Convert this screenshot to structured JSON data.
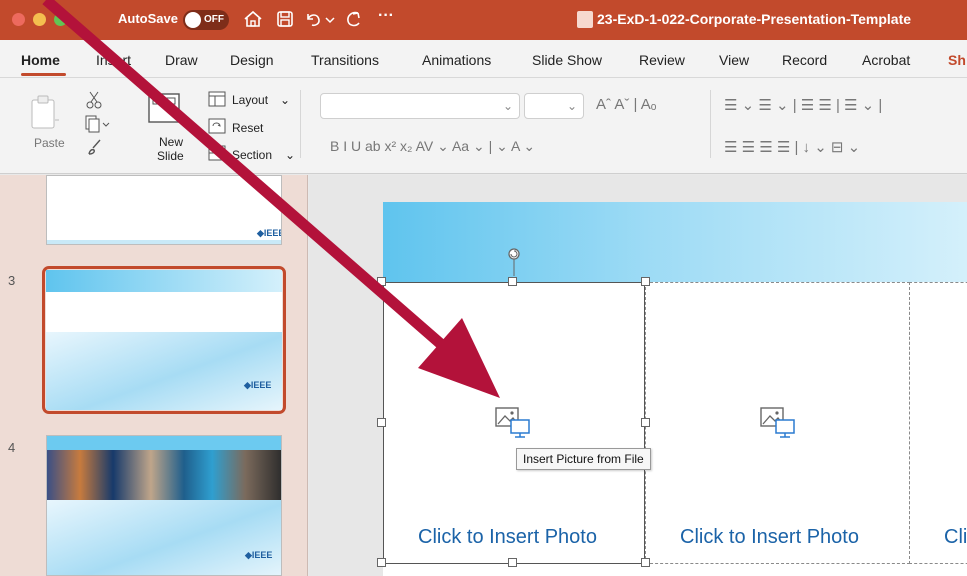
{
  "titlebar": {
    "autosave_label": "AutoSave",
    "toggle_state": "OFF",
    "more_glyph": "···",
    "filename": "23-ExD-1-022-Corporate-Presentation-Template",
    "colors": {
      "bar": "#c24a2c",
      "close": "#ed6a5e",
      "min": "#f4bf4f",
      "max": "#61c554"
    }
  },
  "tabs": [
    "Home",
    "Insert",
    "Draw",
    "Design",
    "Transitions",
    "Animations",
    "Slide Show",
    "Review",
    "View",
    "Record",
    "Acrobat",
    "Sh"
  ],
  "active_tab": "Home",
  "ribbon": {
    "paste_label": "Paste",
    "new_slide_line1": "New",
    "new_slide_line2": "Slide",
    "layout_label": "Layout",
    "reset_label": "Reset",
    "section_label": "Section",
    "font_row_glyphs": "Aˆ  Aˇ  |  Aₒ",
    "format_row": "B   I   U   ab   x²   x₂   AV ⌄   Aa ⌄  |   ⌄   A ⌄",
    "para_row1": "☰ ⌄  ☰ ⌄  |  ☰  ☰  |  ☰ ⌄  |",
    "para_row2": "☰  ☰  ☰  ☰  |  ↓ ⌄  ⊟ ⌄"
  },
  "thumbnails": [
    {
      "number": "",
      "logo": "◆IEEE"
    },
    {
      "number": "3",
      "logo": "◆IEEE"
    },
    {
      "number": "4",
      "logo": "◆IEEE"
    }
  ],
  "slide": {
    "placeholders": [
      {
        "label": "Click to Insert Photo"
      },
      {
        "label": "Click to Insert Photo"
      },
      {
        "label": "Cli"
      }
    ],
    "tooltip": "Insert Picture from File"
  },
  "icons": {
    "home": "home-icon",
    "save": "save-icon",
    "undo": "undo-icon",
    "redo": "redo-icon",
    "cut": "scissors-icon",
    "copy": "copy-icon",
    "format_painter": "brush-icon",
    "insert_picture": "insert-picture-icon",
    "rotate": "rotate-handle-icon"
  },
  "annotation_arrow_color": "#b3123a"
}
